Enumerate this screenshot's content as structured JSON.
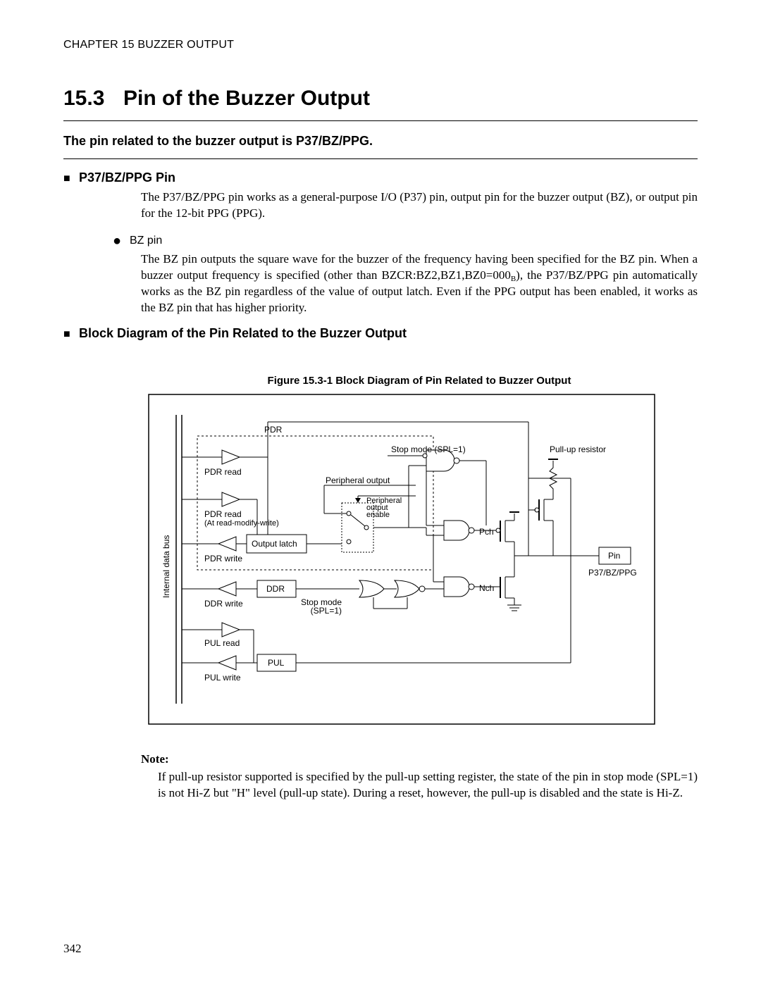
{
  "header": {
    "chapter_line": "CHAPTER 15  BUZZER OUTPUT"
  },
  "title": {
    "number": "15.3",
    "text": "Pin of the Buzzer Output"
  },
  "lead": "The pin related to the buzzer output is P37/BZ/PPG.",
  "sect1": {
    "heading": "P37/BZ/PPG Pin",
    "para": "The P37/BZ/PPG pin works as a general-purpose I/O (P37) pin, output pin for the buzzer output (BZ), or output pin for the 12-bit PPG (PPG)."
  },
  "bz": {
    "label": "BZ pin",
    "para_a": "The BZ pin outputs the square wave for the buzzer of the frequency having been specified for the BZ pin. When a buzzer output frequency is specified (other than BZCR:BZ2,BZ1,BZ0=000",
    "para_sub": "B",
    "para_b": "), the P37/BZ/PPG pin automatically works as the BZ pin regardless of the value of output latch. Even if the PPG output has been enabled, it works as the BZ pin that has higher priority."
  },
  "sect2": {
    "heading": "Block Diagram of the Pin Related to the Buzzer Output"
  },
  "figure": {
    "caption": "Figure 15.3-1  Block Diagram of Pin Related to Buzzer Output",
    "labels": {
      "bus": "Internal data bus",
      "pdr": "PDR",
      "pdr_read": "PDR read",
      "pdr_read_rmw1": "PDR read",
      "pdr_read_rmw2": "(At read-modify-write)",
      "output_latch": "Output latch",
      "pdr_write": "PDR write",
      "ddr": "DDR",
      "ddr_write": "DDR write",
      "pul": "PUL",
      "pul_read": "PUL read",
      "pul_write": "PUL write",
      "periph_out": "Peripheral output",
      "periph_out_en1": "Peripheral",
      "periph_out_en2": "output",
      "periph_out_en3": "enable",
      "stop_mode": "Stop mode (SPL=1)",
      "stop_mode2a": "Stop mode",
      "stop_mode2b": "(SPL=1)",
      "pch": "Pch",
      "nch": "Nch",
      "pin": "Pin",
      "pin_name": "P37/BZ/PPG",
      "pullup": "Pull-up resistor"
    }
  },
  "note": {
    "head": "Note:",
    "body": "If pull-up resistor supported is specified by the pull-up setting register, the state of the pin in stop mode (SPL=1) is not Hi-Z but \"H\" level (pull-up state). During a reset, however, the pull-up is disabled and the state is Hi-Z."
  },
  "page_number": "342"
}
